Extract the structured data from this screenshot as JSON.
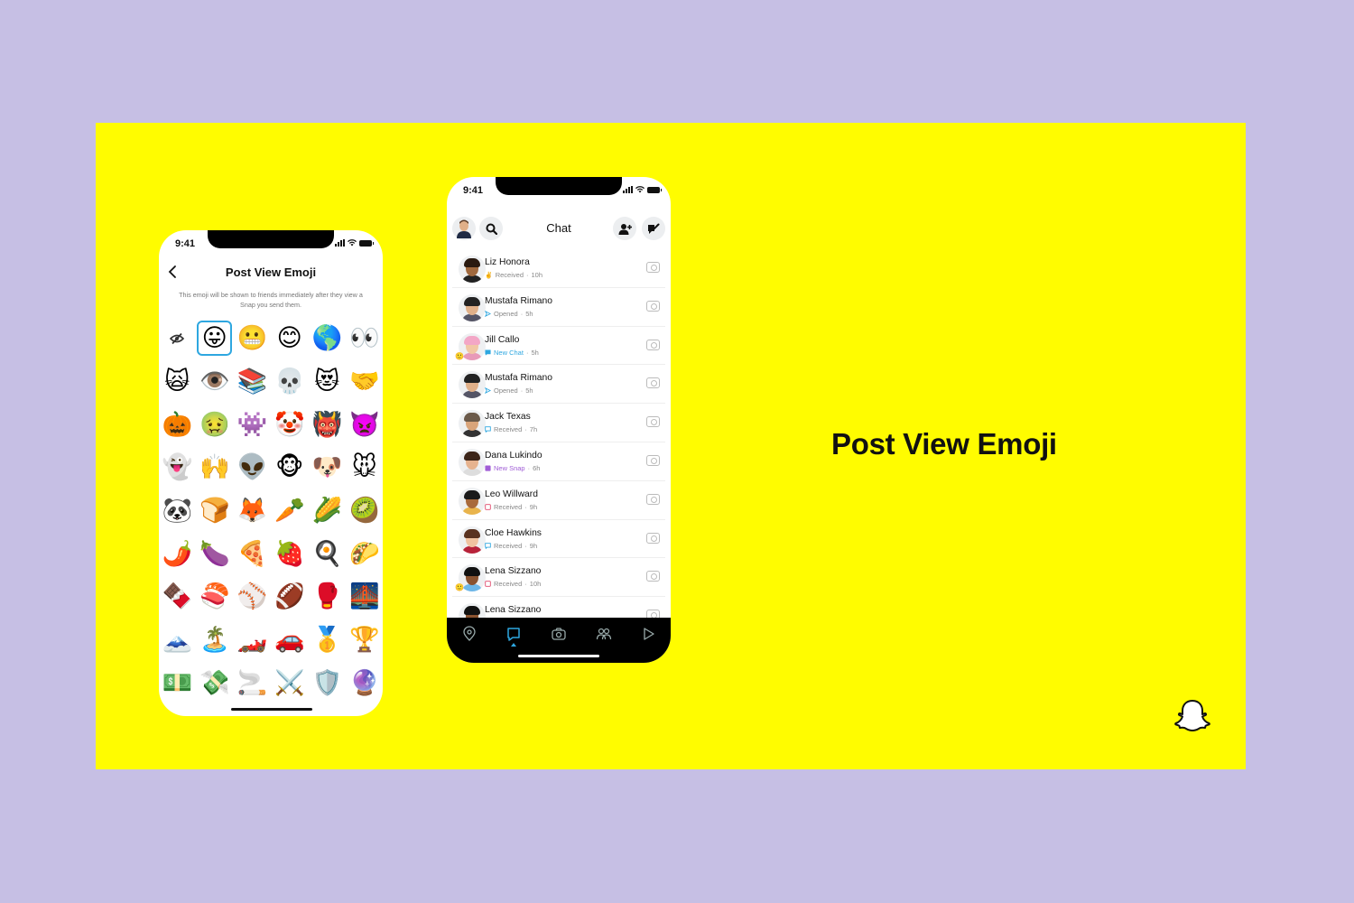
{
  "headline": "Post View Emoji",
  "colors": {
    "background": "#c6bfe4",
    "canvas": "#fffc00",
    "accent": "#2ea7e0",
    "new_snap": "#a05dd6",
    "received_red": "#e0476b"
  },
  "left_phone": {
    "status_time": "9:41",
    "back_icon": "‹",
    "title": "Post View Emoji",
    "description": "This emoji will be shown to friends immediately after they view a Snap you send them.",
    "hide_icon": "⊘",
    "emojis": [
      "😛",
      "😬",
      "😊",
      "🌎",
      "👀",
      "🙀",
      "👁️",
      "📚",
      "💀",
      "😻",
      "🤝",
      "🎃",
      "🤢",
      "👾",
      "🤡",
      "👹",
      "👿",
      "👻",
      "🙌",
      "👽",
      "🐵",
      "🐶",
      "🐭",
      "🐼",
      "🍞",
      "🦊",
      "🥕",
      "🌽",
      "🥝",
      "🌶️",
      "🍆",
      "🍕",
      "🍓",
      "🍳",
      "🌮",
      "🍫",
      "🍣",
      "⚾",
      "🏈",
      "🥊",
      "🌉",
      "🗻",
      "🏝️",
      "🏎️",
      "🚗",
      "🥇",
      "🏆",
      "💵",
      "💸",
      "🚬",
      "⚔️",
      "🛡️",
      "🔮"
    ],
    "selected_index": 0
  },
  "right_phone": {
    "status_time": "9:41",
    "title": "Chat",
    "chats": [
      {
        "name": "Liz Honora",
        "status": "Received",
        "time": "10h",
        "type": "received-emoji",
        "marker": "✌️",
        "skin": "#a0693e",
        "hair": "#2a1a10",
        "shirt": "#222"
      },
      {
        "name": "Mustafa Rimano",
        "status": "Opened",
        "time": "5h",
        "type": "opened",
        "skin": "#e0b089",
        "hair": "#222",
        "shirt": "#556"
      },
      {
        "name": "Jill Callo",
        "status": "New Chat",
        "time": "5h",
        "type": "new-chat",
        "skin": "#f1c7a5",
        "hair": "#f3a6c6",
        "shirt": "#e89ab9",
        "mini_emoji": "🙂"
      },
      {
        "name": "Mustafa Rimano",
        "status": "Opened",
        "time": "5h",
        "type": "opened",
        "skin": "#e0b089",
        "hair": "#222",
        "shirt": "#556"
      },
      {
        "name": "Jack Texas",
        "status": "Received",
        "time": "7h",
        "type": "received-chat",
        "skin": "#d9a47a",
        "hair": "#6b5a4a",
        "shirt": "#333"
      },
      {
        "name": "Dana Lukindo",
        "status": "New Snap",
        "time": "6h",
        "type": "new-snap",
        "skin": "#e6b38f",
        "hair": "#3b2418",
        "shirt": "#ddd"
      },
      {
        "name": "Leo Willward",
        "status": "Received",
        "time": "9h",
        "type": "received-snap",
        "skin": "#a86a3c",
        "hair": "#1a1a1a",
        "shirt": "#e9b44c"
      },
      {
        "name": "Cloe Hawkins",
        "status": "Received",
        "time": "9h",
        "type": "received-chat",
        "skin": "#f0c3a0",
        "hair": "#5a3320",
        "shirt": "#b8233a"
      },
      {
        "name": "Lena Sizzano",
        "status": "Received",
        "time": "10h",
        "type": "received-snap",
        "skin": "#8a5330",
        "hair": "#111",
        "shirt": "#6db7e8",
        "mini_emoji": "🙂"
      },
      {
        "name": "Lena Sizzano",
        "status": "",
        "time": "",
        "type": "partial",
        "skin": "#8a5330",
        "hair": "#111",
        "shirt": "#6db7e8"
      }
    ],
    "nav": [
      "map-icon",
      "chat-icon",
      "camera-icon",
      "friends-icon",
      "discover-icon"
    ],
    "active_nav": "chat-icon"
  }
}
